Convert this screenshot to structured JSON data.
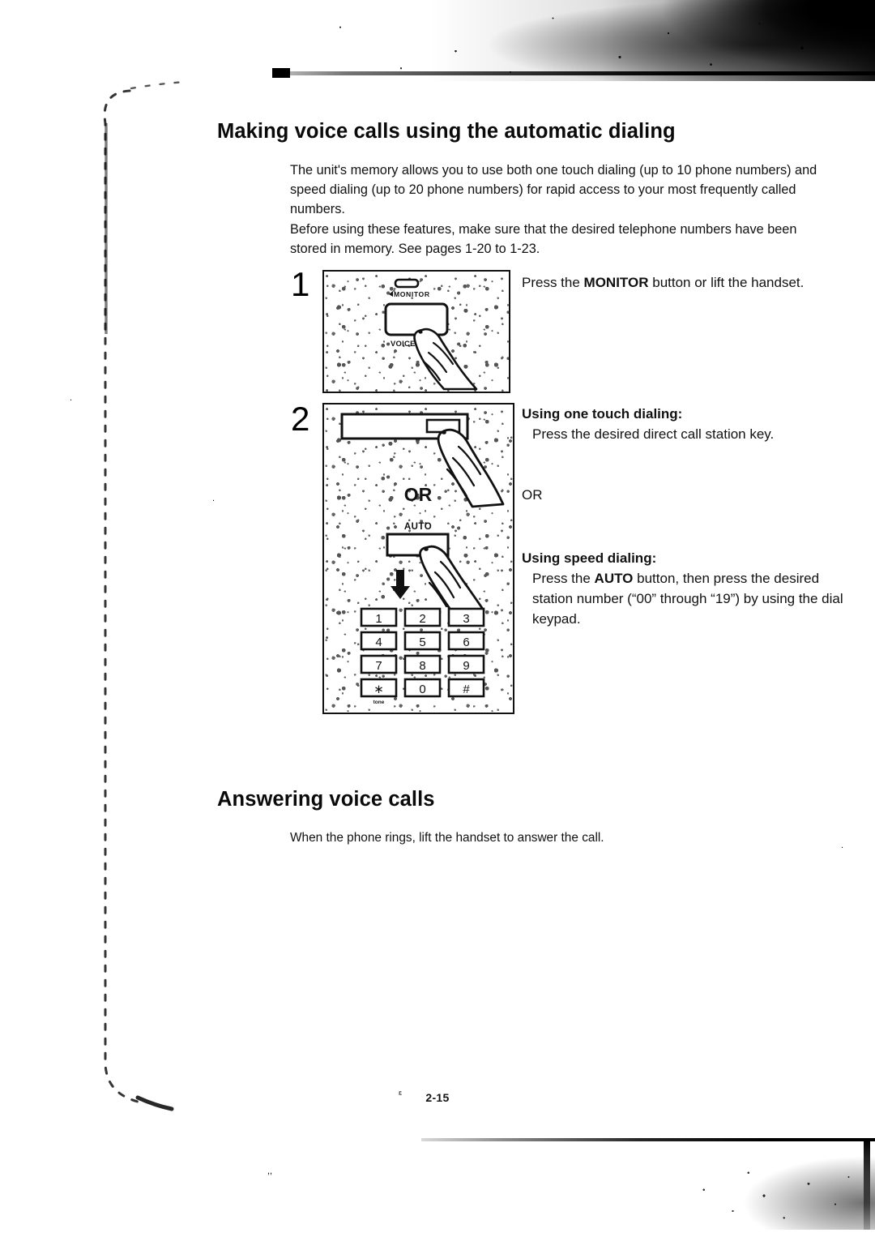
{
  "document": {
    "page_number": "2-15",
    "sections": [
      {
        "id": "making",
        "heading": "Making voice calls using the automatic dialing",
        "intro": "The unit's memory allows you to use both one touch dialing (up to 10 phone numbers) and speed dialing (up to 20 phone numbers) for rapid access to your most frequently called numbers.\nBefore using these features, make sure that the desired telephone numbers have been stored in memory. See pages 1-20 to 1-23."
      },
      {
        "id": "answering",
        "heading": "Answering voice calls",
        "intro": "When the phone rings, lift the handset to answer the call."
      }
    ]
  },
  "steps": [
    {
      "number": "1",
      "instruction_prefix": "Press the ",
      "instruction_bold": "MONITOR",
      "instruction_suffix": " button or lift the handset.",
      "figure": {
        "caption_labels": [
          "MONITOR",
          "VOICE ST"
        ],
        "led_label": "",
        "alt": "Finger pressing the MONITOR button on the telephone console"
      }
    },
    {
      "number": "2",
      "option_a": {
        "heading": "Using one touch dialing:",
        "body": "Press the desired direct call station key."
      },
      "separator": "OR",
      "option_b": {
        "heading": "Using speed dialing:",
        "body_prefix": "Press the ",
        "body_bold": "AUTO",
        "body_suffix": " button, then press the desired station number (“00” through “19”) by using the dial keypad."
      },
      "figure": {
        "or_label": "OR",
        "auto_label": "AUTO",
        "tone_label": "tone",
        "keypad": [
          [
            "1",
            "2",
            "3"
          ],
          [
            "4",
            "5",
            "6"
          ],
          [
            "7",
            "8",
            "9"
          ],
          [
            "∗",
            "0",
            "#"
          ]
        ],
        "alt": "Finger pressing a direct call station key, OR, finger pressing the AUTO button then the dial keypad"
      }
    }
  ],
  "colors": {
    "ink": "#111111",
    "paper": "#ffffff",
    "artifact": "#000000"
  }
}
